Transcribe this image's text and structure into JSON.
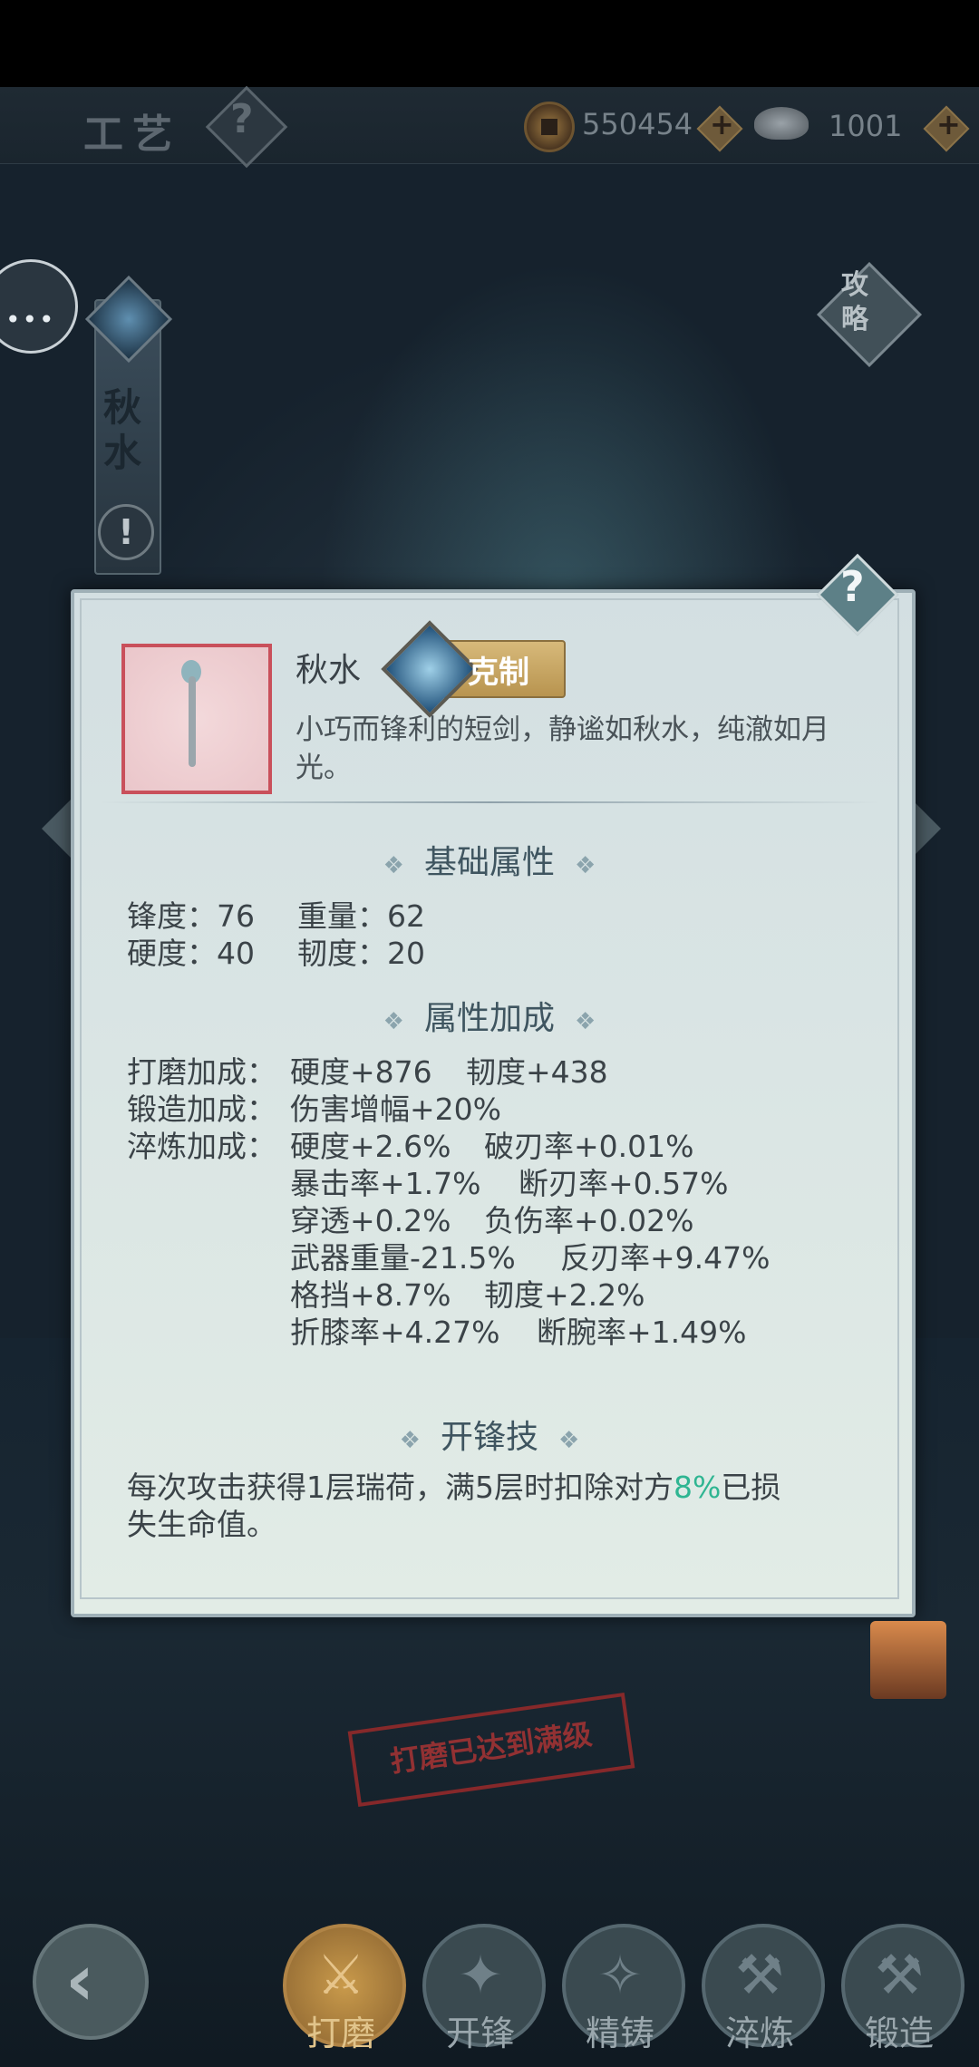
{
  "header": {
    "title": "工艺",
    "help_icon": "question-mark",
    "currency": [
      {
        "icon": "copper-coin-icon",
        "value": "550454",
        "add": "+"
      },
      {
        "icon": "silver-ingot-icon",
        "value": "1001",
        "add": "+"
      }
    ]
  },
  "sidebar": {
    "chat_dots": "•••",
    "weapon_tab_chars": [
      "秋",
      "水"
    ],
    "alert": "!"
  },
  "strategy": {
    "label": "攻略"
  },
  "panel": {
    "help": "?",
    "item_name": "秋水",
    "badge": "克制",
    "description": "小巧而锋利的短剑，静谧如秋水，纯澈如月光。",
    "base_title": "基础属性",
    "ornament": "❖",
    "base_stats": [
      [
        "锋度：76",
        "重量：62"
      ],
      [
        "硬度：40",
        "韧度：20"
      ]
    ],
    "bonus_title": "属性加成",
    "bonus": {
      "grind_label": "打磨加成：",
      "grind_values": [
        "硬度+876",
        "韧度+438"
      ],
      "forge_label": "锻造加成：",
      "forge_values": [
        "伤害增幅+20%"
      ],
      "temper_label": "淬炼加成：",
      "temper_rows": [
        [
          "硬度+2.6%",
          "破刃率+0.01%"
        ],
        [
          "暴击率+1.7%",
          "断刃率+0.57%"
        ],
        [
          "穿透+0.2%",
          "负伤率+0.02%"
        ],
        [
          "武器重量-21.5%",
          "反刃率+9.47%"
        ],
        [
          "格挡+8.7%",
          "韧度+2.2%"
        ],
        [
          "折膝率+4.27%",
          "断腕率+1.49%"
        ]
      ]
    },
    "skill_title": "开锋技",
    "skill_desc_part1": "每次攻击获得1层瑞荷，满5层时扣除对方",
    "skill_desc_highlight": "8%",
    "skill_desc_part2": "已损",
    "skill_desc_line2": "失生命值。",
    "highlight_color": "#2fb592"
  },
  "stamp": "打磨已达到满级",
  "nav": {
    "back": "‹",
    "tabs": [
      {
        "label": "打磨",
        "active": true
      },
      {
        "label": "开锋",
        "active": false
      },
      {
        "label": "精铸",
        "active": false
      },
      {
        "label": "淬炼",
        "active": false
      },
      {
        "label": "锻造",
        "active": false
      }
    ]
  }
}
